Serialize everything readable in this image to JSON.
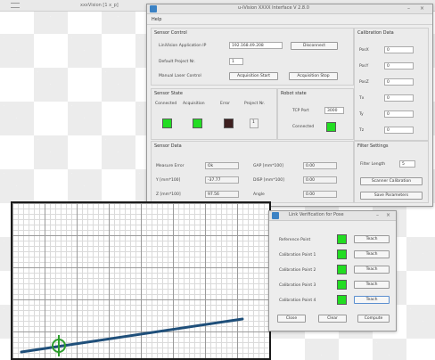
{
  "background_window": {
    "title": "xxxVision [1 x_p]"
  },
  "main_window": {
    "title": "u-iVision XXXX Interface V 2.8.0",
    "menu": [
      "Help"
    ],
    "sensor_control": {
      "title": "Sensor Control",
      "ip_label": "LiniVision Application IP",
      "ip_value": "192.168.49.208",
      "disconnect_label": "Disconnect",
      "project_label": "Default Project Nr.",
      "project_value": "1",
      "manual_label": "Manual Laser Control",
      "acq_start_label": "Acquisition Start",
      "acq_stop_label": "Acquisition Stop"
    },
    "sensor_state": {
      "title": "Sensor State",
      "connected_label": "Connected",
      "acquisition_label": "Acquisition",
      "error_label": "Error",
      "project_label": "Project Nr.",
      "project_value": "1",
      "led_colors": {
        "ok": "#22dd22",
        "error": "#3e2020"
      }
    },
    "robot_state": {
      "title": "Robot state",
      "port_label": "TCP Port",
      "port_value": "3000",
      "connected_label": "Connected"
    },
    "calibration_data": {
      "title": "Calibration Data",
      "rows": [
        {
          "label": "PosX",
          "value": "0"
        },
        {
          "label": "PosY",
          "value": "0"
        },
        {
          "label": "PosZ",
          "value": "0"
        },
        {
          "label": "Tx",
          "value": "0"
        },
        {
          "label": "Ty",
          "value": "0"
        },
        {
          "label": "Tz",
          "value": "0"
        }
      ]
    },
    "sensor_data": {
      "title": "Sensor Data",
      "measure_error_label": "Measure Error",
      "measure_error_value": "Ok",
      "gap_label": "GAP [mm*100]",
      "gap_value": "0.00",
      "y_label": "Y [mm*100]",
      "y_value": "-37.77",
      "disp_label": "DISP [mm*100]",
      "disp_value": "0.00",
      "z_label": "Z [mm*100]",
      "z_value": "97.56",
      "angle_label": "Angle",
      "angle_value": "0.00"
    },
    "filter_settings": {
      "title": "Filter Settings",
      "length_label": "Filter Length",
      "length_value": "5",
      "scanner_calib_label": "Scanner Calibration",
      "save_params_label": "Save Parameters"
    }
  },
  "calib_dialog": {
    "title": "Link Verification for Pose",
    "rows": [
      {
        "label": "Reference Point",
        "button": "Teach"
      },
      {
        "label": "Calibration Point 1",
        "button": "Teach"
      },
      {
        "label": "Calibration Point 2",
        "button": "Teach"
      },
      {
        "label": "Calibration Point 3",
        "button": "Teach"
      },
      {
        "label": "Calibration Point 4",
        "button": "Teach"
      }
    ],
    "close_label": "Close",
    "clear_label": "Clear",
    "compute_label": "Compute"
  },
  "colors": {
    "accent_led": "#22dd22",
    "profile_line": "#1f4f7a",
    "marker": "#2e9e2e"
  }
}
